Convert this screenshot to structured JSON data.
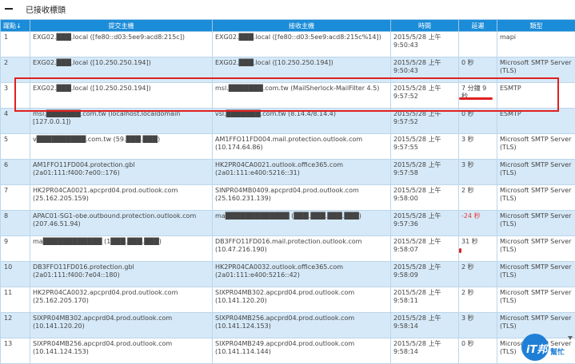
{
  "section": {
    "title": "已接收標頭"
  },
  "table": {
    "columns": [
      "躍點↓",
      "提交主機",
      "接收主機",
      "時間",
      "延遲",
      "類型"
    ],
    "rows": [
      [
        "1",
        "EXG02.███.local ([fe80::d03:5ee9:acd8:215c])",
        "EXG02.███.local ([fe80::d03:5ee9:acd8:215c%14])",
        "2015/5/28 上午 9:50:43",
        "",
        "mapi"
      ],
      [
        "2",
        "EXG02.███.local ([10.250.250.194])",
        "EXG02.███.local ([10.250.250.194])",
        "2015/5/28 上午 9:50:43",
        "0 秒",
        "Microsoft SMTP Server (TLS)"
      ],
      [
        "3",
        "EXG02.███.local ([10.250.250.194])",
        "msl.███████.com.tw (MailSherlock-MailFilter 4.5)",
        "2015/5/28 上午 9:57:52",
        "7 分鐘 9 秒",
        "ESMTP"
      ],
      [
        "4",
        "msl.███████.com.tw (localhost.localdomain [127.0.0.1])",
        "vsl.███████.com.tw (8.14.4/8.14.4)",
        "2015/5/28 上午 9:57:52",
        "0 秒",
        "ESMTP"
      ],
      [
        "5",
        "v██████████.com.tw (59.███.███)",
        "AM1FFO11FD004.mail.protection.outlook.com (10.174.64.86)",
        "2015/5/28 上午 9:57:55",
        "3 秒",
        "Microsoft SMTP Server (TLS)"
      ],
      [
        "6",
        "AM1FFO11FD004.protection.gbl (2a01:111:f400:7e00::176)",
        "HK2PR04CA0021.outlook.office365.com (2a01:111:e400:5216::31)",
        "2015/5/28 上午 9:57:58",
        "3 秒",
        "Microsoft SMTP Server (TLS)"
      ],
      [
        "7",
        "HK2PR04CA0021.apcprd04.prod.outlook.com (25.162.205.159)",
        "SINPR04MB0409.apcprd04.prod.outlook.com (25.160.231.139)",
        "2015/5/28 上午 9:58:00",
        "2 秒",
        "Microsoft SMTP Server (TLS)"
      ],
      [
        "8",
        "APAC01-SG1-obe.outbound.protection.outlook.com (207.46.51.94)",
        "ma█████████████ (███.███.███.███)",
        "2015/5/28 上午 9:57:36",
        "-24 秒",
        "Microsoft SMTP Server (TLS)"
      ],
      [
        "9",
        "ma████████████ (1███.███.███)",
        "DB3FFO11FD016.mail.protection.outlook.com (10.47.216.190)",
        "2015/5/28 上午 9:58:07",
        "31 秒",
        "Microsoft SMTP Server (TLS)"
      ],
      [
        "10",
        "DB3FFO11FD016.protection.gbl (2a01:111:f400:7e04::180)",
        "HK2PR04CA0032.outlook.office365.com (2a01:111:e400:5216::42)",
        "2015/5/28 上午 9:58:09",
        "2 秒",
        "Microsoft SMTP Server (TLS)"
      ],
      [
        "11",
        "HK2PR04CA0032.apcprd04.prod.outlook.com (25.162.205.170)",
        "SIXPR04MB302.apcprd04.prod.outlook.com (10.141.120.20)",
        "2015/5/28 上午 9:58:11",
        "2 秒",
        "Microsoft SMTP Server (TLS)"
      ],
      [
        "12",
        "SIXPR04MB302.apcprd04.prod.outlook.com (10.141.120.20)",
        "SIXPR04MB256.apcprd04.prod.outlook.com (10.141.124.153)",
        "2015/5/28 上午 9:58:14",
        "3 秒",
        "Microsoft SMTP Server (TLS)"
      ],
      [
        "13",
        "SIXPR04MB256.apcprd04.prod.outlook.com (10.141.124.153)",
        "SIXPR04MB249.apcprd04.prod.outlook.com (10.141.114.144)",
        "2015/5/28 上午 9:58:14",
        "0 秒",
        "Microsoft SMTP Server (TLS)"
      ]
    ]
  },
  "watermark": {
    "logo_text": "iT邦",
    "sub_text": "幫忙"
  },
  "colors": {
    "header_bg": "#1b8cd8",
    "row_alt_bg": "#d6e9f8",
    "annotation": "#e02020",
    "negative_delay": "#e53935"
  },
  "icons": {
    "collapse": "minus-icon",
    "scroll": "scroll-down-arrow-icon"
  }
}
